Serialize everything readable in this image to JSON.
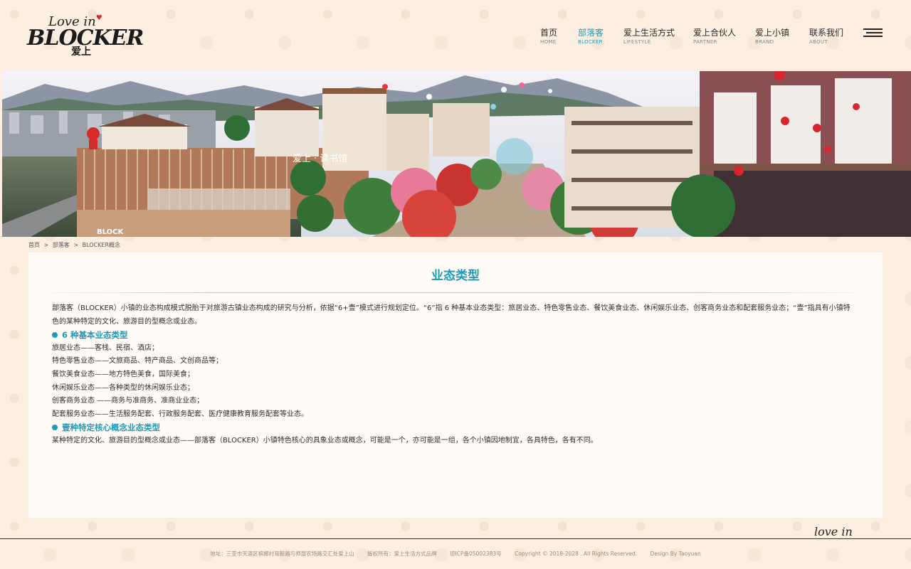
{
  "logo": {
    "top": "Love in",
    "main": "BLOCKER",
    "cn": "爱上"
  },
  "nav": {
    "items": [
      {
        "cn": "首页",
        "en": "HOME"
      },
      {
        "cn": "部落客",
        "en": "BLOCKER"
      },
      {
        "cn": "爱上生活方式",
        "en": "LIFESTYLE"
      },
      {
        "cn": "爱上合伙人",
        "en": "PARTNER"
      },
      {
        "cn": "爱上小镇",
        "en": "BRAND"
      },
      {
        "cn": "联系我们",
        "en": "ABOUT"
      }
    ],
    "active_index": 1
  },
  "banner": {
    "sign_text": "爱上 · 读书馆",
    "corner_text": "BLOCK"
  },
  "breadcrumb": {
    "items": [
      "首页",
      "部落客",
      "BLOCKER概念"
    ],
    "separator": ">"
  },
  "main": {
    "title": "业态类型",
    "intro": "部落客（BLOCKER）小镇的业态构成模式脱胎于对旅游古镇业态构成的研究与分析，依据“6+壹”模式进行规划定位。“6”指 6 种基本业态类型：旅居业态、特色零售业态、餐饮美食业态、休闲娱乐业态、创客商务业态和配套服务业态；“壹”指具有小镇特色的某种特定的文化、旅游目的型概念或业态。",
    "section1_title": "6 种基本业态类型",
    "section1_lines": [
      "旅居业态——客栈、民宿、酒店；",
      "特色零售业态——文旅商品、特产商品、文创商品等；",
      "餐饮美食业态——地方特色美食，国际美食；",
      "休闲娱乐业态——各种类型的休闲娱乐业态；",
      "创客商务业态 ——商务与准商务、准商业业态；",
      "配套服务业态——生活服务配套、行政服务配套、医疗健康教育服务配套等业态。"
    ],
    "section2_title": "壹种特定核心概念业态类型",
    "section2_text": "某种特定的文化、旅游目的型概念或业态——部落客（BLOCKER）小镇特色核心的具象业态或概念，可能是一个，亦可能是一组，各个小镇因地制宜，各具特色，各有不同。"
  },
  "footer": {
    "signature": "love in",
    "address": "地址：三亚市天涯区槟榔村育新路与师部农场路交汇处爱上山",
    "rights": "版权所有：爱上生活方式品牌",
    "icp": "琼ICP备05002383号",
    "copyright": "Copyright © 2018-2028 . All Rights Reserved.",
    "design": "Design By Taoyuan"
  },
  "colors": {
    "accent": "#1f9ab5",
    "background": "#fcefe2"
  }
}
